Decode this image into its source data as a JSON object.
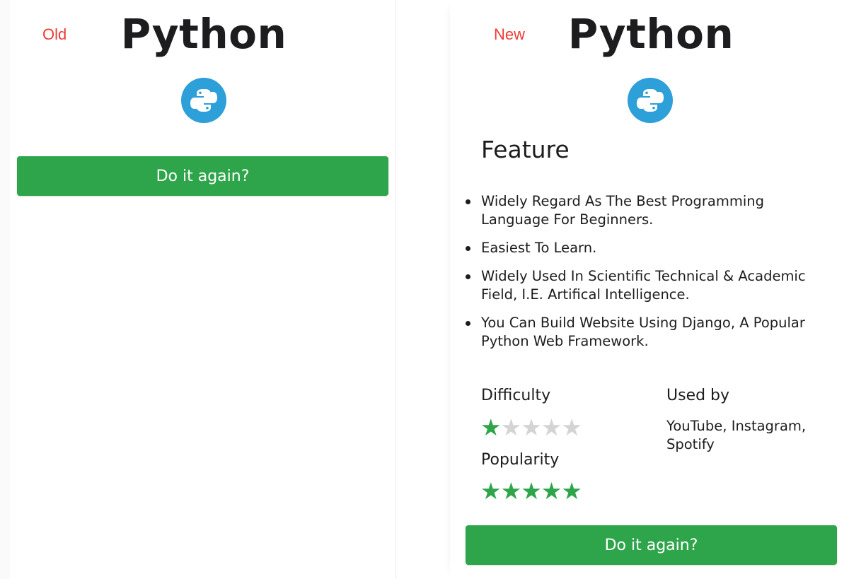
{
  "old": {
    "tag": "Old",
    "title": "Python",
    "logo_icon": "python-icon",
    "button_label": "Do it again?"
  },
  "new": {
    "tag": "New",
    "title": "Python",
    "logo_icon": "python-icon",
    "feature_heading": "Feature",
    "features": [
      "Widely Regard As The Best Programming Language For Beginners.",
      "Easiest To Learn.",
      "Widely Used In Scientific Technical & Academic Field, I.E. Artifical Intelligence.",
      "You Can Build Website Using Django, A Popular Python Web Framework."
    ],
    "difficulty_label": "Difficulty",
    "difficulty_rating": 1,
    "popularity_label": "Popularity",
    "popularity_rating": 5,
    "rating_max": 5,
    "used_by_label": "Used by",
    "used_by_value": "YouTube, Instagram, Spotify",
    "button_label": "Do it again?"
  },
  "colors": {
    "accent_green": "#2ea54b",
    "tag_red": "#ef3b36",
    "python_blue": "#2d9fd9",
    "star_empty": "#d4d4d4"
  }
}
